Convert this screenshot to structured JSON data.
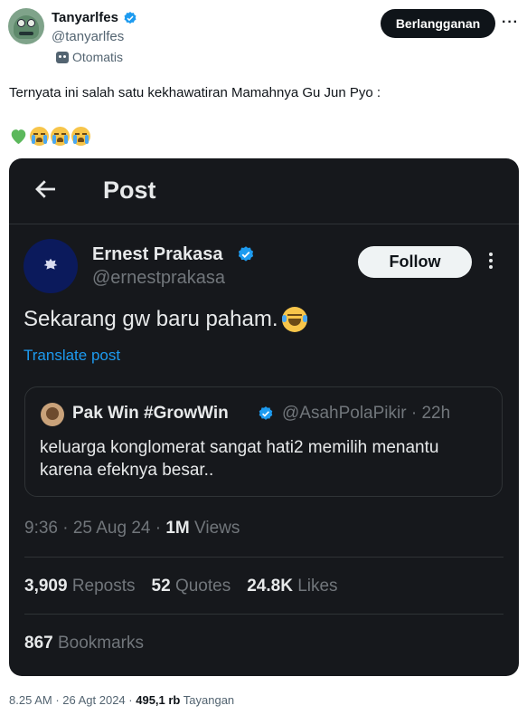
{
  "tweet": {
    "display_name": "Tanyarlfes",
    "handle": "@tanyarlfes",
    "auto_label": "Otomatis",
    "subscribe_label": "Berlangganan",
    "more_label": "···",
    "text": "Ternyata ini salah satu kekhawatiran Mamahnya Gu Jun Pyo :",
    "emojis": [
      "green-heart",
      "loudly-crying",
      "loudly-crying",
      "loudly-crying"
    ],
    "footer": {
      "time": "8.25 AM",
      "sep1": " · ",
      "date": "26 Agt 2024",
      "sep2": " · ",
      "views_count": "495,1 rb",
      "views_label": " Tayangan"
    }
  },
  "embed": {
    "header_title": "Post",
    "author": {
      "name": "Ernest Prakasa",
      "handle": "@ernestprakasa",
      "follow_label": "Follow"
    },
    "post_text": "Sekarang gw baru paham.",
    "translate_label": "Translate post",
    "quote": {
      "name": "Pak Win #GrowWin",
      "handle": "@AsahPolaPikir · 22h",
      "text": "keluarga konglomerat sangat hati2 memilih menantu karena efeknya besar.."
    },
    "meta": {
      "time_date": "9:36 · 25 Aug 24 · ",
      "views_count": "1M",
      "views_label": " Views"
    },
    "stats": {
      "reposts_count": "3,909",
      "reposts_label": " Reposts",
      "quotes_count": "52",
      "quotes_label": " Quotes",
      "likes_count": "24.8K",
      "likes_label": " Likes",
      "bookmarks_count": "867",
      "bookmarks_label": " Bookmarks"
    }
  },
  "colors": {
    "verified_blue": "#1d9bf0",
    "dark_bg": "#16181c",
    "link_blue": "#1d9bf0"
  }
}
